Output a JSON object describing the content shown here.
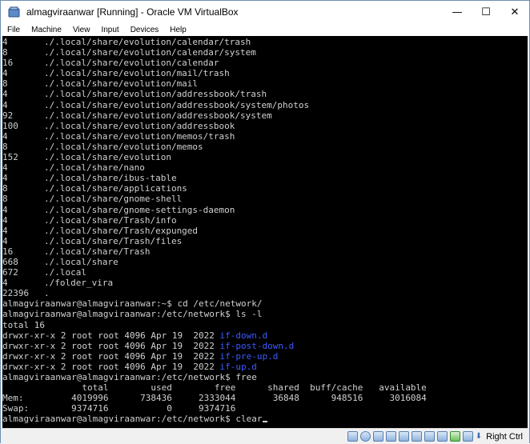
{
  "window": {
    "title": "almagviraanwar [Running] - Oracle VM VirtualBox",
    "minimize_glyph": "—",
    "maximize_glyph": "☐",
    "close_glyph": "✕"
  },
  "menu": [
    "File",
    "Machine",
    "View",
    "Input",
    "Devices",
    "Help"
  ],
  "terminal": {
    "du_lines": [
      {
        "size": "4",
        "path": "./.local/share/evolution/calendar/trash"
      },
      {
        "size": "8",
        "path": "./.local/share/evolution/calendar/system"
      },
      {
        "size": "16",
        "path": "./.local/share/evolution/calendar"
      },
      {
        "size": "4",
        "path": "./.local/share/evolution/mail/trash"
      },
      {
        "size": "8",
        "path": "./.local/share/evolution/mail"
      },
      {
        "size": "4",
        "path": "./.local/share/evolution/addressbook/trash"
      },
      {
        "size": "4",
        "path": "./.local/share/evolution/addressbook/system/photos"
      },
      {
        "size": "92",
        "path": "./.local/share/evolution/addressbook/system"
      },
      {
        "size": "100",
        "path": "./.local/share/evolution/addressbook"
      },
      {
        "size": "4",
        "path": "./.local/share/evolution/memos/trash"
      },
      {
        "size": "8",
        "path": "./.local/share/evolution/memos"
      },
      {
        "size": "152",
        "path": "./.local/share/evolution"
      },
      {
        "size": "4",
        "path": "./.local/share/nano"
      },
      {
        "size": "4",
        "path": "./.local/share/ibus-table"
      },
      {
        "size": "8",
        "path": "./.local/share/applications"
      },
      {
        "size": "8",
        "path": "./.local/share/gnome-shell"
      },
      {
        "size": "4",
        "path": "./.local/share/gnome-settings-daemon"
      },
      {
        "size": "4",
        "path": "./.local/share/Trash/info"
      },
      {
        "size": "4",
        "path": "./.local/share/Trash/expunged"
      },
      {
        "size": "4",
        "path": "./.local/share/Trash/files"
      },
      {
        "size": "16",
        "path": "./.local/share/Trash"
      },
      {
        "size": "668",
        "path": "./.local/share"
      },
      {
        "size": "672",
        "path": "./.local"
      },
      {
        "size": "4",
        "path": "./folder_vira"
      },
      {
        "size": "22396",
        "path": "."
      }
    ],
    "cmd_cd": "almagviraanwar@almagviraanwar:~$ cd /etc/network/",
    "cmd_ls": "almagviraanwar@almagviraanwar:/etc/network$ ls -l",
    "ls_total": "total 16",
    "ls_lines": [
      {
        "meta": "drwxr-xr-x 2 root root 4096 Apr 19  2022 ",
        "name": "if-down.d"
      },
      {
        "meta": "drwxr-xr-x 2 root root 4096 Apr 19  2022 ",
        "name": "if-post-down.d"
      },
      {
        "meta": "drwxr-xr-x 2 root root 4096 Apr 19  2022 ",
        "name": "if-pre-up.d"
      },
      {
        "meta": "drwxr-xr-x 2 root root 4096 Apr 19  2022 ",
        "name": "if-up.d"
      }
    ],
    "cmd_free": "almagviraanwar@almagviraanwar:/etc/network$ free",
    "free_header": "               total        used        free      shared  buff/cache   available",
    "free_mem": "Mem:         4019996      738436     2333044       36848      948516     3016084",
    "free_swap": "Swap:        9374716           0     9374716",
    "cmd_clear_prompt": "almagviraanwar@almagviraanwar:/etc/network$ ",
    "cmd_clear": "clear"
  },
  "status": {
    "host_key": "Right Ctrl"
  },
  "colors": {
    "terminal_bg": "#000000",
    "terminal_fg": "#d0d0d0",
    "dir_color": "#3b5bff"
  }
}
